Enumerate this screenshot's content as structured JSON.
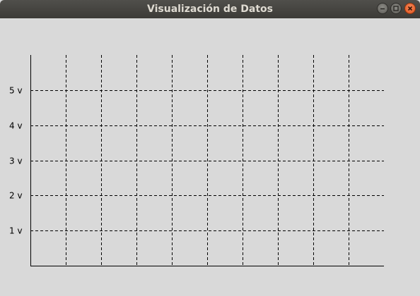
{
  "window": {
    "title": "Visualización de Datos"
  },
  "titlebar_buttons": {
    "minimize_icon": "minimize-icon",
    "maximize_icon": "maximize-icon",
    "close_icon": "close-icon"
  },
  "colors": {
    "background": "#d9d9d9",
    "titlebar": "#3c3b37",
    "close_button": "#e9541f",
    "grid": "#000000"
  },
  "chart_data": {
    "type": "line",
    "title": "",
    "xlabel": "",
    "ylabel": "",
    "y_unit": "v",
    "yticks": [
      1,
      2,
      3,
      4,
      5
    ],
    "ytick_labels": [
      "1 v",
      "2 v",
      "3 v",
      "4 v",
      "5 v"
    ],
    "ylim": [
      0,
      6
    ],
    "x_gridlines": 9,
    "grid": true,
    "grid_style": "dashed",
    "series": []
  }
}
